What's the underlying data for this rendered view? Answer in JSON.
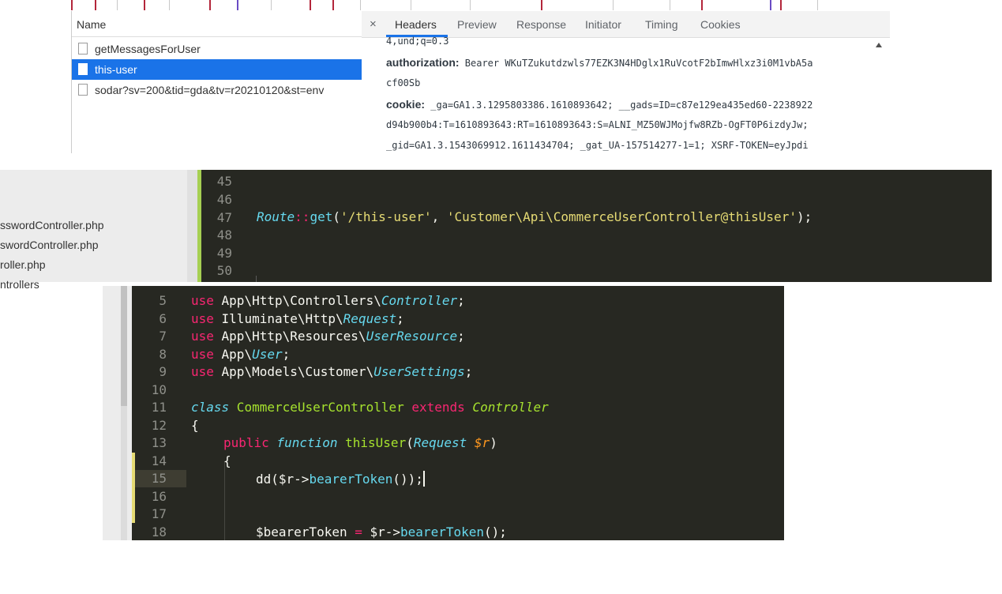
{
  "devtools": {
    "name_header": "Name",
    "requests": [
      {
        "label": "getMessagesForUser",
        "selected": false
      },
      {
        "label": "this-user",
        "selected": true
      },
      {
        "label": "sodar?sv=200&tid=gda&tv=r20210120&st=env",
        "selected": false
      }
    ],
    "close_label": "×",
    "tabs": [
      "Headers",
      "Preview",
      "Response",
      "Initiator",
      "Timing",
      "Cookies"
    ],
    "active_tab": "Headers",
    "header_lines": {
      "l1_value": "4,und;q=0.3",
      "auth_key": "authorization:",
      "auth_value": " Bearer WKuTZukutdzwls77EZK3N4HDglx1RuVcotF2bImwHlxz3i0M1vbA5a",
      "auth_cont": "cf00Sb",
      "cookie_key": "cookie:",
      "cookie_value": " _ga=GA1.3.1295803386.1610893642; __gads=ID=c87e129ea435ed60-2238922",
      "cookie_cont1": "d94b900b4:T=1610893643:RT=1610893643:S=ALNI_MZ50WJMojfw8RZb-OgFT0P6izdyJw;",
      "cookie_cont2": "_gid=GA1.3.1543069912.1611434704; _gat_UA-157514277-1=1; XSRF-TOKEN=eyJpdi"
    }
  },
  "file_tree": {
    "items": [
      "sswordController.php",
      "swordController.php",
      "roller.php",
      "ntrollers"
    ]
  },
  "routes_editor": {
    "line_numbers": [
      "45",
      "46",
      "47",
      "48",
      "49",
      "50"
    ],
    "route_line": {
      "class": "Route",
      "op": "::",
      "method": "get",
      "open": "(",
      "path": "'/this-user'",
      "comma": ", ",
      "action": "'Customer\\Api\\CommerceUserController@thisUser'",
      "close": ");"
    }
  },
  "controller_editor": {
    "line_numbers": [
      "5",
      "6",
      "7",
      "8",
      "9",
      "10",
      "11",
      "12",
      "13",
      "14",
      "15",
      "16",
      "17",
      "18"
    ],
    "active_line": "15",
    "use_keyword": "use",
    "uses": [
      {
        "ns": " App\\Http\\Controllers\\",
        "cls": "Controller",
        "end": ";"
      },
      {
        "ns": " Illuminate\\Http\\",
        "cls": "Request",
        "end": ";"
      },
      {
        "ns": " App\\Http\\Resources\\",
        "cls": "UserResource",
        "end": ";"
      },
      {
        "ns": " App\\",
        "cls": "User",
        "end": ";"
      },
      {
        "ns": " App\\Models\\Customer\\",
        "cls": "UserSettings",
        "end": ";"
      }
    ],
    "class_line": {
      "kw": "class",
      "name": " CommerceUserController",
      "extends": " extends",
      "parent": " Controller"
    },
    "open_brace": "{",
    "method_line": {
      "pub": "public",
      "fn": " function",
      "name": " thisUser",
      "open": "(",
      "type": "Request",
      "sp": " ",
      "var": "$r",
      "close": ")"
    },
    "method_brace": "{",
    "dd_line": {
      "dd": "dd",
      "open": "($r->",
      "call": "bearerToken",
      "close": "());"
    },
    "token_line": {
      "var": "$bearerToken",
      "eq": " = ",
      "obj": "$r->",
      "call": "bearerToken",
      "close": "();"
    }
  },
  "colors": {
    "editor_bg": "#272822",
    "keyword": "#f92672",
    "storage": "#66d9ef",
    "class_name": "#a6e22e",
    "string": "#e6db74",
    "variable": "#fd971f",
    "devtools_selection": "#1a73e8"
  }
}
